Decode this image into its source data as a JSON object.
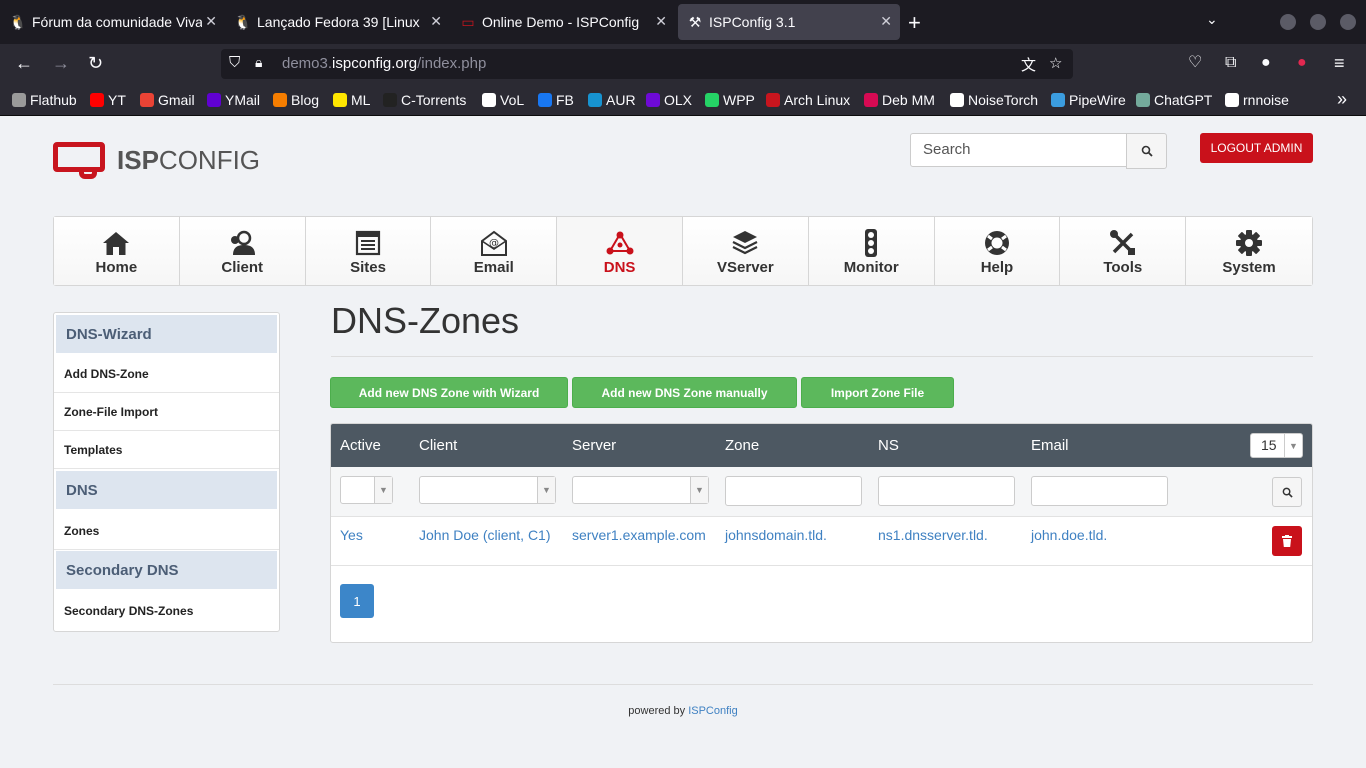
{
  "browser": {
    "tabs": [
      {
        "title": "Fórum da comunidade Viva"
      },
      {
        "title": "Lançado Fedora 39 [Linux"
      },
      {
        "title": "Online Demo - ISPConfig"
      },
      {
        "title": "ISPConfig 3.1"
      }
    ],
    "url_prefix": "demo3.",
    "url_domain": "ispconfig.org",
    "url_path": "/index.php",
    "bookmarks": [
      {
        "label": "Flathub",
        "color": "#9a9a9a"
      },
      {
        "label": "YT",
        "color": "#ff0000"
      },
      {
        "label": "Gmail",
        "color": "#ea4335"
      },
      {
        "label": "YMail",
        "color": "#6001d2"
      },
      {
        "label": "Blog",
        "color": "#f57d00"
      },
      {
        "label": "ML",
        "color": "#ffe600"
      },
      {
        "label": "C-Torrents",
        "color": "#222222"
      },
      {
        "label": "VoL",
        "color": "#ffffff"
      },
      {
        "label": "FB",
        "color": "#1877f2"
      },
      {
        "label": "AUR",
        "color": "#1793d1"
      },
      {
        "label": "OLX",
        "color": "#6e0ad6"
      },
      {
        "label": "WPP",
        "color": "#25d366"
      },
      {
        "label": "Arch Linux",
        "color": "#c8151e"
      },
      {
        "label": "Deb MM",
        "color": "#d70a53"
      },
      {
        "label": "NoiseTorch",
        "color": "#ffffff"
      },
      {
        "label": "PipeWire",
        "color": "#3b9de0"
      },
      {
        "label": "ChatGPT",
        "color": "#74aa9c"
      },
      {
        "label": "rnnoise",
        "color": "#ffffff"
      }
    ]
  },
  "header": {
    "logo_bold": "ISP",
    "logo_rest": "CONFIG",
    "search_placeholder": "Search",
    "logout_label": "LOGOUT ADMIN"
  },
  "mainnav": [
    {
      "label": "Home",
      "icon": "home-icon"
    },
    {
      "label": "Client",
      "icon": "client-icon"
    },
    {
      "label": "Sites",
      "icon": "sites-icon"
    },
    {
      "label": "Email",
      "icon": "email-icon"
    },
    {
      "label": "DNS",
      "icon": "dns-icon",
      "active": true
    },
    {
      "label": "VServer",
      "icon": "vserver-icon"
    },
    {
      "label": "Monitor",
      "icon": "monitor-icon"
    },
    {
      "label": "Help",
      "icon": "help-icon"
    },
    {
      "label": "Tools",
      "icon": "tools-icon"
    },
    {
      "label": "System",
      "icon": "system-icon"
    }
  ],
  "sidebar": {
    "groups": [
      {
        "title": "DNS-Wizard",
        "items": [
          "Add DNS-Zone",
          "Zone-File Import",
          "Templates"
        ]
      },
      {
        "title": "DNS",
        "items": [
          "Zones"
        ]
      },
      {
        "title": "Secondary DNS",
        "items": [
          "Secondary DNS-Zones"
        ]
      }
    ]
  },
  "page": {
    "title": "DNS-Zones",
    "buttons": [
      "Add new DNS Zone with Wizard",
      "Add new DNS Zone manually",
      "Import Zone File"
    ]
  },
  "table": {
    "columns": [
      "Active",
      "Client",
      "Server",
      "Zone",
      "NS",
      "Email"
    ],
    "per_page": "15",
    "rows": [
      {
        "active": "Yes",
        "client": "John Doe (client, C1)",
        "server": "server1.example.com",
        "zone": "johnsdomain.tld.",
        "ns": "ns1.dnsserver.tld.",
        "email": "john.doe.tld."
      }
    ],
    "current_page": "1"
  },
  "footer": {
    "text": "powered by",
    "link": "ISPConfig"
  },
  "colors": {
    "brand_red": "#c9111b",
    "green_button": "#5cb85c",
    "table_header": "#4d5862",
    "link_blue": "#3f81c2",
    "sidebar_header": "#dde5ef"
  }
}
